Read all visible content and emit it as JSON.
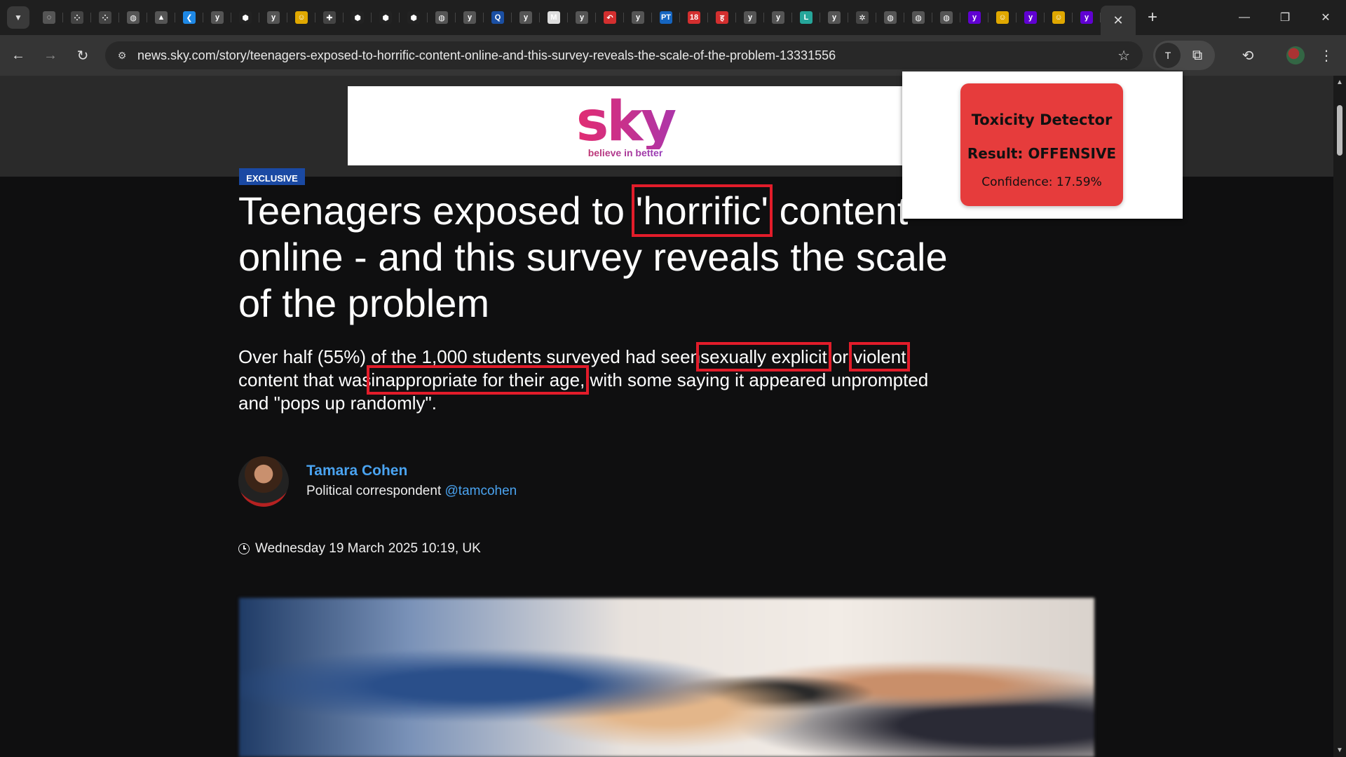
{
  "browser": {
    "tabs": [
      {
        "icon": "globe-sync-icon",
        "glyph": "◌",
        "color": "#555"
      },
      {
        "icon": "dots-icon",
        "glyph": "⁘",
        "color": "#444"
      },
      {
        "icon": "dots-icon",
        "glyph": "⁘",
        "color": "#444"
      },
      {
        "icon": "globe-icon",
        "glyph": "◍",
        "color": "#555"
      },
      {
        "icon": "drive-icon",
        "glyph": "▲",
        "color": "#555"
      },
      {
        "icon": "vscode-icon",
        "glyph": "❮",
        "color": "#1e88e5"
      },
      {
        "icon": "y-icon",
        "glyph": "y",
        "color": "#555"
      },
      {
        "icon": "cube-icon",
        "glyph": "⬢",
        "color": "#222"
      },
      {
        "icon": "y-icon",
        "glyph": "y",
        "color": "#555"
      },
      {
        "icon": "hugging-face-icon",
        "glyph": "☺",
        "color": "#e0a800"
      },
      {
        "icon": "puzzle-icon",
        "glyph": "✚",
        "color": "#444"
      },
      {
        "icon": "cube-icon",
        "glyph": "⬢",
        "color": "#222"
      },
      {
        "icon": "cube-icon",
        "glyph": "⬢",
        "color": "#222"
      },
      {
        "icon": "cube-icon",
        "glyph": "⬢",
        "color": "#222"
      },
      {
        "icon": "globe-icon",
        "glyph": "◍",
        "color": "#555"
      },
      {
        "icon": "y-icon",
        "glyph": "y",
        "color": "#555"
      },
      {
        "icon": "quiz-icon",
        "glyph": "Q",
        "color": "#1a4fa3"
      },
      {
        "icon": "y-icon",
        "glyph": "y",
        "color": "#555"
      },
      {
        "icon": "mw-icon",
        "glyph": "M",
        "color": "#ddd"
      },
      {
        "icon": "y-icon",
        "glyph": "y",
        "color": "#555"
      },
      {
        "icon": "reply-icon",
        "glyph": "↶",
        "color": "#d32f2f"
      },
      {
        "icon": "y-icon",
        "glyph": "y",
        "color": "#555"
      },
      {
        "icon": "pt-icon",
        "glyph": "PT",
        "color": "#1565c0"
      },
      {
        "icon": "eighteen-icon",
        "glyph": "18",
        "color": "#d32f2f"
      },
      {
        "icon": "hindi-icon",
        "glyph": "ह",
        "color": "#d32f2f"
      },
      {
        "icon": "y-icon",
        "glyph": "y",
        "color": "#555"
      },
      {
        "icon": "y-icon",
        "glyph": "y",
        "color": "#555"
      },
      {
        "icon": "l-icon",
        "glyph": "L",
        "color": "#26a69a"
      },
      {
        "icon": "y-icon",
        "glyph": "y",
        "color": "#555"
      },
      {
        "icon": "openai-icon",
        "glyph": "✲",
        "color": "#444"
      },
      {
        "icon": "globe-icon",
        "glyph": "◍",
        "color": "#555"
      },
      {
        "icon": "globe-icon",
        "glyph": "◍",
        "color": "#555"
      },
      {
        "icon": "globe-icon",
        "glyph": "◍",
        "color": "#555"
      },
      {
        "icon": "yahoo-icon",
        "glyph": "y",
        "color": "#6001d2"
      },
      {
        "icon": "hugging-face-icon",
        "glyph": "☺",
        "color": "#e0a800"
      },
      {
        "icon": "yahoo-icon",
        "glyph": "y",
        "color": "#6001d2"
      },
      {
        "icon": "hugging-face-icon",
        "glyph": "☺",
        "color": "#e0a800"
      },
      {
        "icon": "yahoo-icon",
        "glyph": "y",
        "color": "#6001d2"
      }
    ],
    "url": "news.sky.com/story/teenagers-exposed-to-horrific-content-online-and-this-survey-reveals-the-scale-of-the-problem-13331556",
    "extension_badge": "T"
  },
  "masthead": {
    "logo_text": "sky",
    "tagline": "believe in better",
    "brand_colors": [
      "#e8332d",
      "#e52c6e",
      "#8c3bcb",
      "#2f61d6"
    ]
  },
  "article": {
    "tag": "EXCLUSIVE",
    "headline": {
      "before": "Teenagers exposed to ",
      "flag": "'horrific'",
      "after": " content online - and this survey reveals the scale of the problem"
    },
    "standfirst": {
      "part1": "Over half (55%) of the 1,000 students surveyed had seen",
      "flag1": "sexually explicit",
      "part2": " or ",
      "flag2": "violent",
      "part3": " content that was",
      "flag3": "inappropriate for their age,",
      "part4": " with some saying it appeared unprompted and \"pops up randomly\"."
    },
    "author": {
      "name": "Tamara Cohen",
      "role": "Political correspondent",
      "handle": "@tamcohen"
    },
    "date": "Wednesday 19 March 2025 10:19, UK"
  },
  "highlight_color": "#e21c2a",
  "popup": {
    "title": "Toxicity Detector",
    "result": "Result: OFFENSIVE",
    "confidence": "Confidence: 17.59%",
    "card_color": "#e63c3c"
  }
}
